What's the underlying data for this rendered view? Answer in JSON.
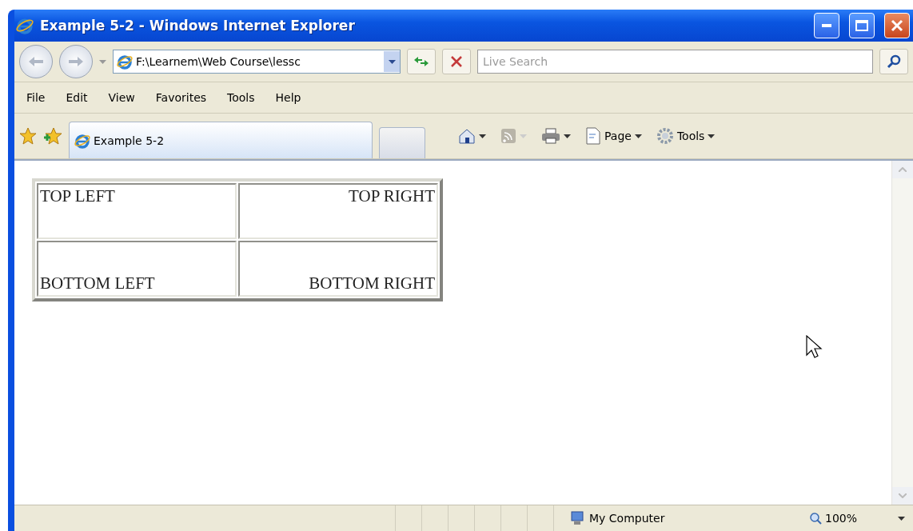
{
  "window": {
    "title": "Example 5-2 - Windows Internet Explorer"
  },
  "address": {
    "value": "F:\\Learnem\\Web Course\\lessc"
  },
  "search": {
    "placeholder": "Live Search"
  },
  "menu": [
    "File",
    "Edit",
    "View",
    "Favorites",
    "Tools",
    "Help"
  ],
  "tabs": [
    {
      "label": "Example 5-2",
      "selected": true
    }
  ],
  "command_bar": [
    {
      "kind": "home"
    },
    {
      "kind": "feeds"
    },
    {
      "kind": "print"
    },
    {
      "kind": "page",
      "label": "Page"
    },
    {
      "kind": "tools",
      "label": "Tools"
    }
  ],
  "table": {
    "rows": [
      [
        {
          "text": "TOP LEFT",
          "kind": "top-left"
        },
        {
          "text": "TOP RIGHT",
          "kind": "top-right"
        }
      ],
      [
        {
          "text": "BOTTOM LEFT",
          "kind": "bottom-left"
        },
        {
          "text": "BOTTOM RIGHT",
          "kind": "bottom-right"
        }
      ]
    ]
  },
  "status_bar": {
    "zone": "My Computer",
    "zoom": "100%"
  }
}
